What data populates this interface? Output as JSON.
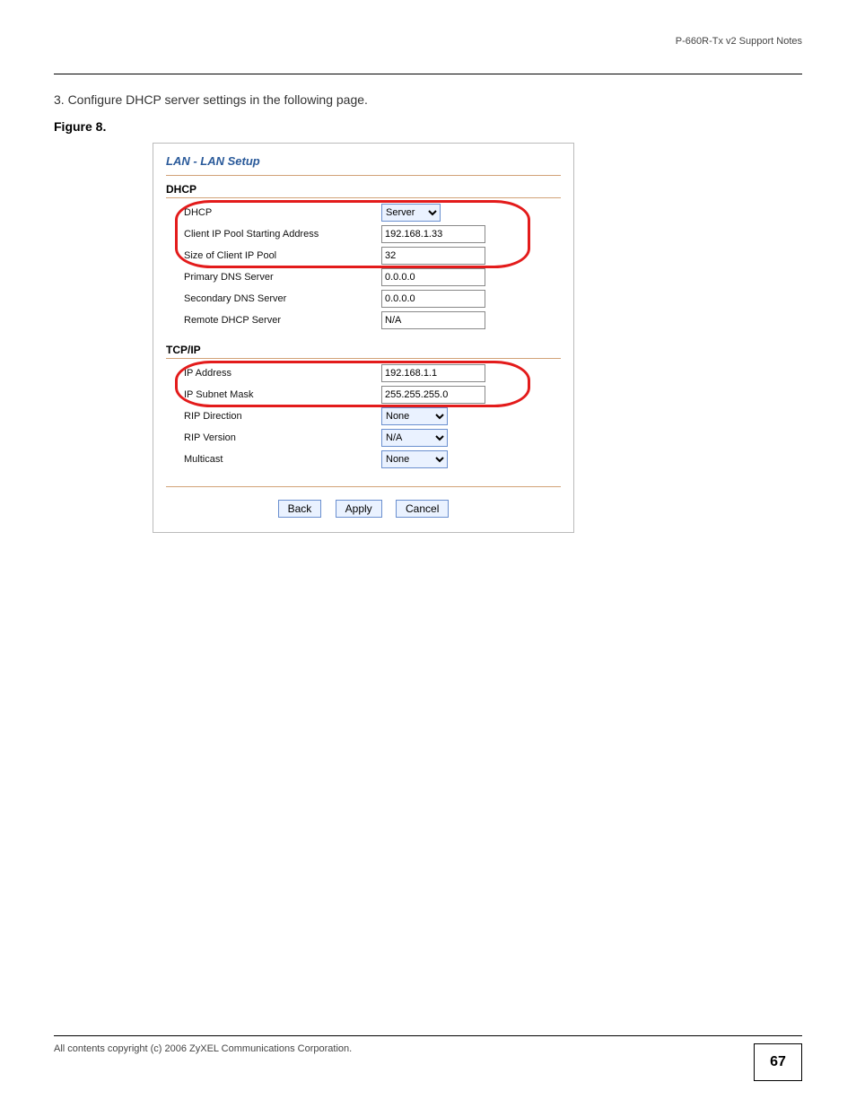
{
  "header": {
    "text": "P-660R-Tx v2 Support Notes"
  },
  "intro": "3. Configure DHCP server settings in the following page.",
  "figure_caption": "Figure 8.",
  "breadcrumb": "LAN - LAN Setup",
  "dhcp": {
    "title": "DHCP",
    "dhcp_label": "DHCP",
    "dhcp_value": "Server",
    "pool_start_label": "Client IP Pool Starting Address",
    "pool_start_value": "192.168.1.33",
    "pool_size_label": "Size of Client IP Pool",
    "pool_size_value": "32",
    "primary_dns_label": "Primary DNS Server",
    "primary_dns_value": "0.0.0.0",
    "secondary_dns_label": "Secondary DNS Server",
    "secondary_dns_value": "0.0.0.0",
    "remote_dhcp_label": "Remote DHCP Server",
    "remote_dhcp_value": "N/A"
  },
  "tcpip": {
    "title": "TCP/IP",
    "ip_label": "IP Address",
    "ip_value": "192.168.1.1",
    "subnet_label": "IP Subnet Mask",
    "subnet_value": "255.255.255.0",
    "rip_dir_label": "RIP Direction",
    "rip_dir_value": "None",
    "rip_ver_label": "RIP Version",
    "rip_ver_value": "N/A",
    "multicast_label": "Multicast",
    "multicast_value": "None"
  },
  "buttons": {
    "back": "Back",
    "apply": "Apply",
    "cancel": "Cancel"
  },
  "footer": {
    "left": "All contents copyright (c) 2006 ZyXEL Communications Corporation.",
    "page": "67"
  }
}
